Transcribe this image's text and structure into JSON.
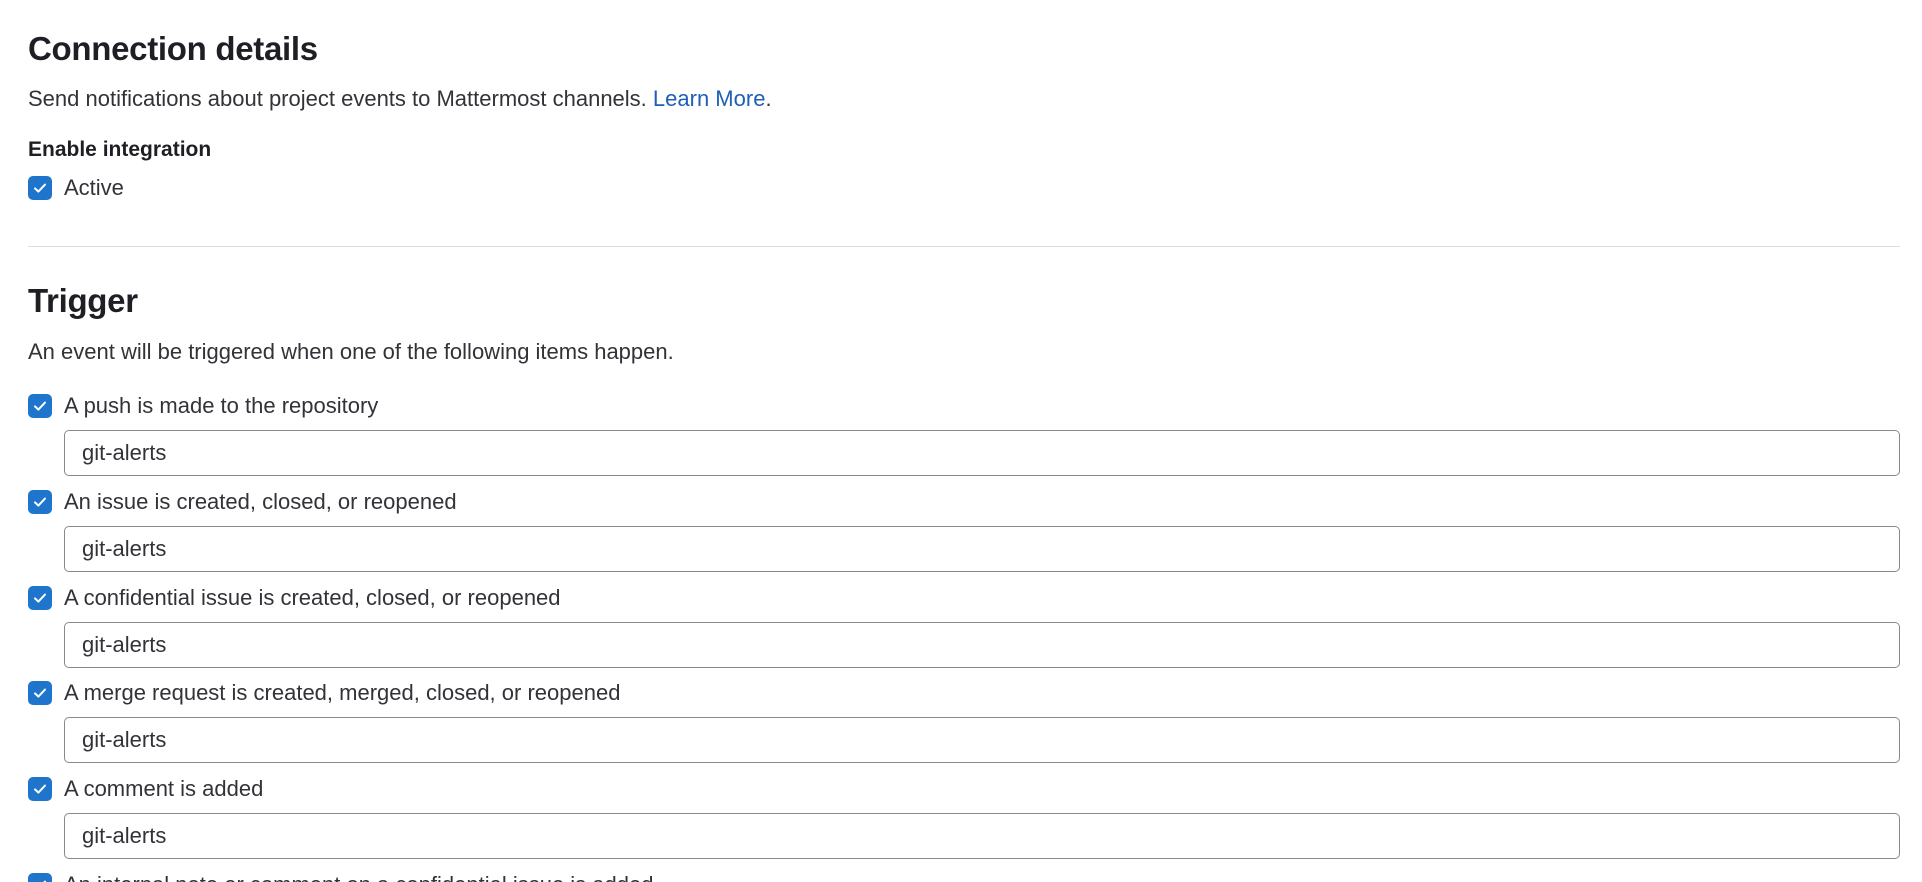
{
  "connection": {
    "title": "Connection details",
    "description": "Send notifications about project events to Mattermost channels.",
    "learn_more": "Learn More",
    "period": ".",
    "enable_label": "Enable integration",
    "active_label": "Active",
    "active_checked": true
  },
  "trigger": {
    "title": "Trigger",
    "description": "An event will be triggered when one of the following items happen.",
    "items": [
      {
        "label": "A push is made to the repository",
        "checked": true,
        "channel": "git-alerts"
      },
      {
        "label": "An issue is created, closed, or reopened",
        "checked": true,
        "channel": "git-alerts"
      },
      {
        "label": "A confidential issue is created, closed, or reopened",
        "checked": true,
        "channel": "git-alerts"
      },
      {
        "label": "A merge request is created, merged, closed, or reopened",
        "checked": true,
        "channel": "git-alerts"
      },
      {
        "label": "A comment is added",
        "checked": true,
        "channel": "git-alerts"
      },
      {
        "label": "An internal note or comment on a confidential issue is added",
        "checked": true
      }
    ]
  },
  "colors": {
    "checkbox": "#1f75cb",
    "link": "#1f5fb8",
    "divider": "#dcdcde"
  }
}
